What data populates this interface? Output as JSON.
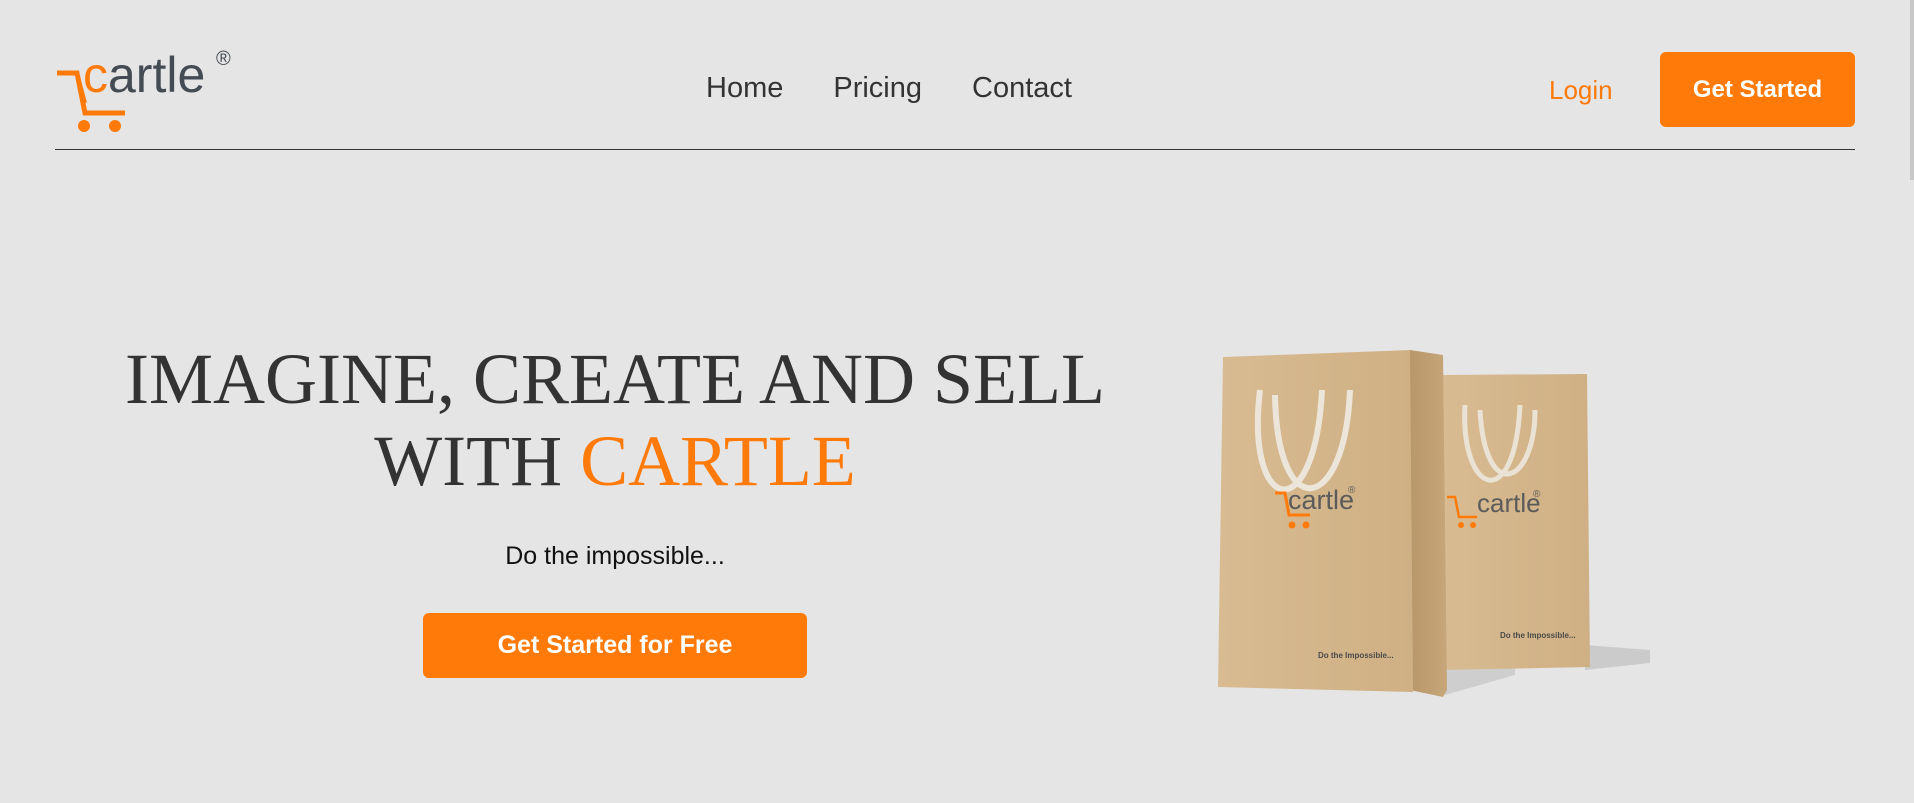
{
  "header": {
    "logo": {
      "text_c": "c",
      "text_rest": "artle",
      "registered": "®"
    },
    "nav": [
      {
        "label": "Home"
      },
      {
        "label": "Pricing"
      },
      {
        "label": "Contact"
      }
    ],
    "login_label": "Login",
    "get_started_label": "Get Started"
  },
  "hero": {
    "title_line1": "IMAGINE, CREATE AND SELL",
    "title_line2_prefix": "WITH ",
    "title_accent": "CARTLE",
    "tagline": "Do the impossible...",
    "cta_label": "Get Started for Free",
    "bag_print": {
      "brand": "cartle",
      "registered": "®",
      "slogan": "Do the Impossible..."
    }
  },
  "colors": {
    "accent": "#ff7a09",
    "text": "#333333",
    "background": "#e5e5e5",
    "bag": "#d4b48a"
  }
}
